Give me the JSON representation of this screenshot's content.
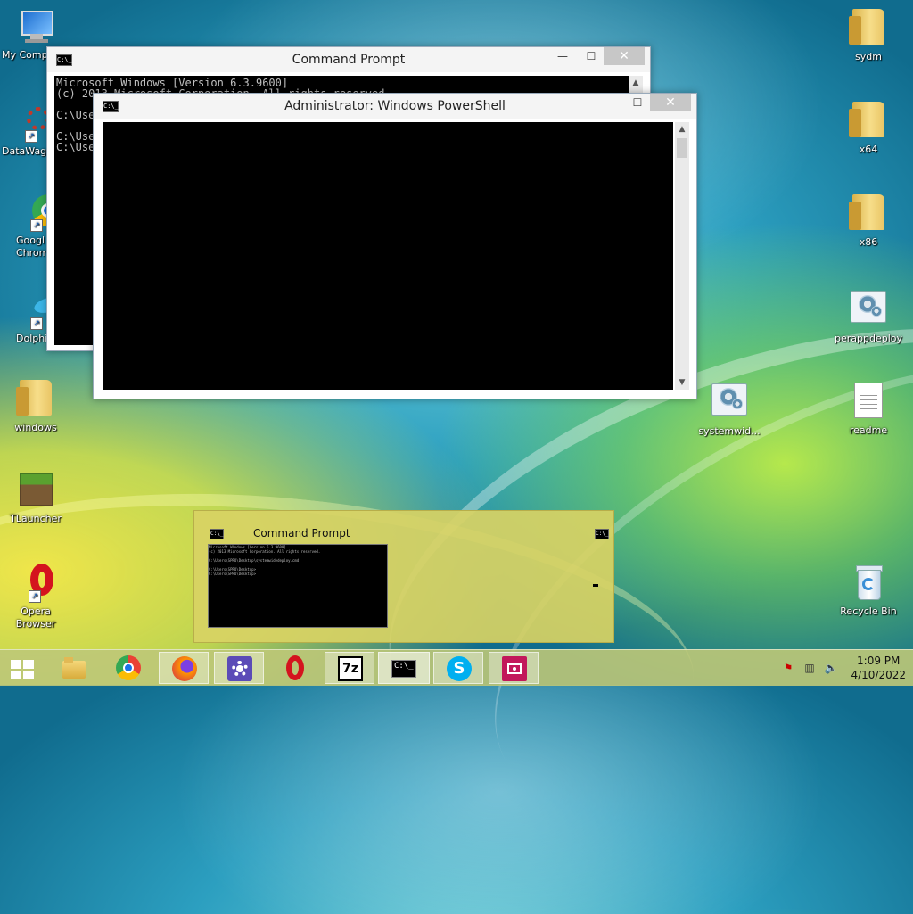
{
  "desktop": {
    "left_icons": [
      {
        "label": "My Comp"
      },
      {
        "label": "DataWag"
      },
      {
        "label": "Googl\nChrom"
      },
      {
        "label": "Dolphi"
      },
      {
        "label": "windows"
      },
      {
        "label": "TLauncher"
      },
      {
        "label": "Opera\nBrowser"
      }
    ],
    "right_icons": [
      {
        "label": "sydm"
      },
      {
        "label": "x64"
      },
      {
        "label": "x86"
      },
      {
        "label": "perappdeploy"
      },
      {
        "label": "systemwid..."
      },
      {
        "label": "readme"
      },
      {
        "label": "Recycle Bin"
      }
    ]
  },
  "cmd_window": {
    "title": "Command Prompt",
    "icon_text": "C:\\_",
    "lines": "Microsoft Windows [Version 6.3.9600]\n(c) 2013 Microsoft Corporation. All rights reserved.\n\nC:\\Use\n\nC:\\Use\nC:\\Use",
    "minimize": "—",
    "maximize": "☐",
    "close": "✕"
  },
  "ps_window": {
    "title": "Administrator: Windows PowerShell",
    "icon_text": "C:\\_",
    "minimize": "—",
    "maximize": "☐",
    "close": "✕"
  },
  "preview": {
    "title": "Command Prompt",
    "icon_text": "C:\\_",
    "thumb_lines": "Microsoft Windows [Version 6.3.9600]\n(c) 2013 Microsoft Corporation. All rights reserved.\n\nC:\\Users\\SPRO\\Desktop\\systemwidedeploy.cmd\n\nC:\\Users\\SPRO\\Desktop>\nC:\\Users\\SPRO\\Desktop>"
  },
  "taskbar": {
    "items": [
      {
        "name": "file-explorer"
      },
      {
        "name": "chrome"
      },
      {
        "name": "firefox"
      },
      {
        "name": "settings"
      },
      {
        "name": "opera"
      },
      {
        "name": "7zip",
        "text": "7z"
      },
      {
        "name": "command-prompt",
        "text": "C:\\_"
      },
      {
        "name": "skype",
        "text": "S"
      },
      {
        "name": "app"
      }
    ],
    "time": "1:09 PM",
    "date": "4/10/2022"
  },
  "colors": {
    "console_bg": "#000000",
    "opera_red": "#d4141e",
    "chrome_blue": "#1a73e8",
    "skype_blue": "#00aff0"
  }
}
